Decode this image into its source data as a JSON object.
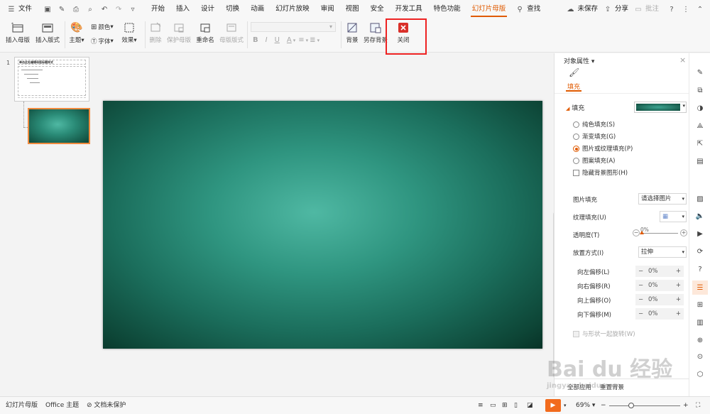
{
  "menubar": {
    "file": "文件",
    "tabs": [
      "开始",
      "插入",
      "设计",
      "切换",
      "动画",
      "幻灯片放映",
      "审阅",
      "视图",
      "安全",
      "开发工具",
      "特色功能",
      "幻灯片母版"
    ],
    "active_tab": "幻灯片母版",
    "search": "查找",
    "unsaved": "未保存",
    "share": "分享",
    "comment": "批注"
  },
  "ribbon": {
    "insert_master": "插入母版",
    "insert_layout": "插入版式",
    "theme": "主题",
    "color": "颜色",
    "font": "字体",
    "effect": "效果",
    "delete": "删除",
    "protect_master": "保护母版",
    "rename": "重命名",
    "master_layout": "母版版式",
    "bold": "B",
    "italic": "I",
    "underline": "U",
    "fontcolor": "A",
    "background": "背景",
    "save_background": "另存背景",
    "close": "关闭"
  },
  "thumbs": {
    "slide_number": "1",
    "master_title": "单击此处编辑母版标题样式"
  },
  "panel": {
    "title": "对象属性",
    "tab_fill": "填充",
    "section_fill": "填充",
    "options": [
      "纯色填充(S)",
      "渐变填充(G)",
      "图片或纹理填充(P)",
      "图案填充(A)"
    ],
    "selected_option": "图片或纹理填充(P)",
    "hide_bg": "隐藏背景图形(H)",
    "picture_fill_label": "图片填充",
    "picture_fill_value": "请选择图片",
    "texture_label": "纹理填充(U)",
    "transparency_label": "透明度(T)",
    "transparency_value": "0%",
    "placement_label": "放置方式(I)",
    "placement_value": "拉伸",
    "offsets": [
      {
        "label": "向左偏移(L)",
        "value": "0%"
      },
      {
        "label": "向右偏移(R)",
        "value": "0%"
      },
      {
        "label": "向上偏移(O)",
        "value": "0%"
      },
      {
        "label": "向下偏移(M)",
        "value": "0%"
      }
    ],
    "rotate_with_shape": "与形状一起旋转(W)",
    "apply_all": "全部应用",
    "reset_bg": "重置背景"
  },
  "status": {
    "mode": "幻灯片母版",
    "theme": "Office 主题",
    "protect": "文档未保护",
    "zoom": "69%"
  },
  "watermark": {
    "brand": "Bai du 经验",
    "url": "jingyan.baidu.com"
  },
  "colors": {
    "accent": "#e05a00",
    "highlight": "#ee2222",
    "close_icon": "#d9302a"
  }
}
